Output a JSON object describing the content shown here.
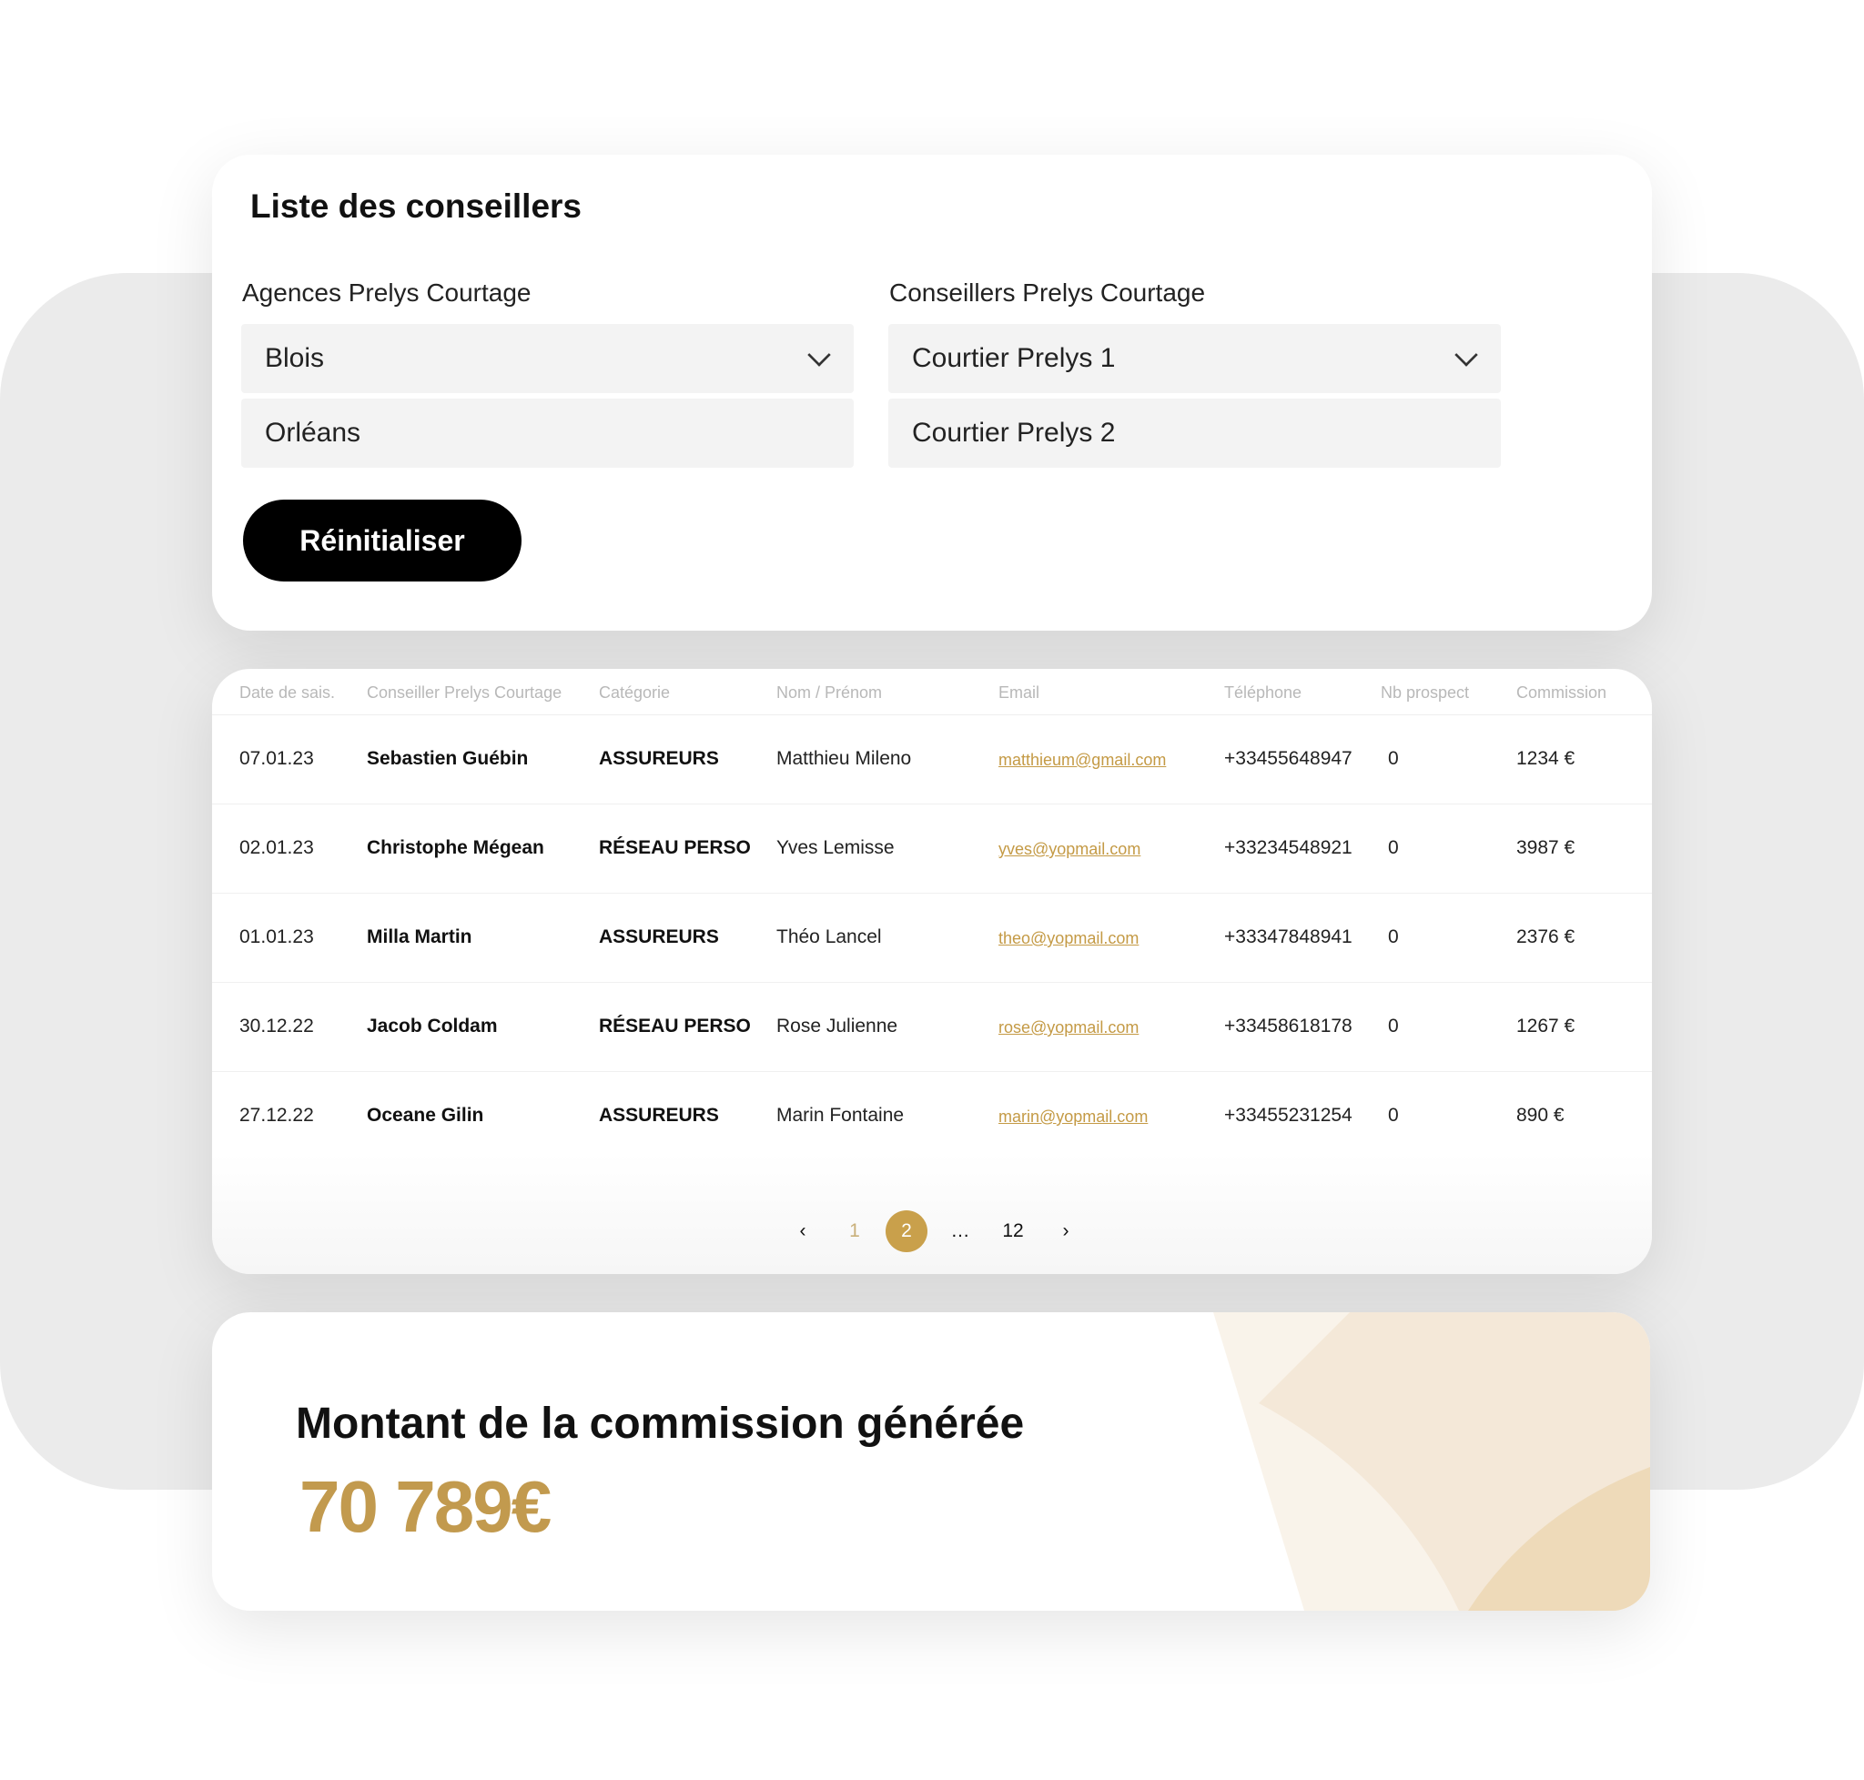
{
  "filters": {
    "title": "Liste des conseillers",
    "agencies_label": "Agences Prelys Courtage",
    "agencies_options": [
      "Blois",
      "Orléans"
    ],
    "advisors_label": "Conseillers Prelys Courtage",
    "advisors_options": [
      "Courtier Prelys 1",
      "Courtier Prelys 2"
    ],
    "reset_label": "Réinitialiser"
  },
  "table": {
    "headers": [
      "Date de sais.",
      "Conseiller Prelys Courtage",
      "Catégorie",
      "Nom / Prénom",
      "Email",
      "Téléphone",
      "Nb prospect",
      "Commission"
    ],
    "rows": [
      [
        "07.01.23",
        "Sebastien Guébin",
        "ASSUREURS",
        "Matthieu Mileno",
        "matthieum@gmail.com",
        "+33455648947",
        "0",
        "1234 €"
      ],
      [
        "02.01.23",
        "Christophe Mégean",
        "RÉSEAU PERSO",
        "Yves Lemisse",
        "yves@yopmail.com",
        "+33234548921",
        "0",
        "3987 €"
      ],
      [
        "01.01.23",
        "Milla Martin",
        "ASSUREURS",
        "Théo Lancel",
        "theo@yopmail.com",
        "+33347848941",
        "0",
        "2376 €"
      ],
      [
        "30.12.22",
        "Jacob Coldam",
        "RÉSEAU PERSO",
        "Rose Julienne",
        "rose@yopmail.com",
        "+33458618178",
        "0",
        "1267 €"
      ],
      [
        "27.12.22",
        "Oceane Gilin",
        "ASSUREURS",
        "Marin Fontaine",
        "marin@yopmail.com",
        "+33455231254",
        "0",
        "890 €"
      ]
    ]
  },
  "pagination": {
    "pages": [
      "1",
      "2",
      "…",
      "12"
    ],
    "current": "2"
  },
  "total": {
    "title": "Montant de la commission générée",
    "amount": "70 789€"
  },
  "colors": {
    "accent": "#c9a04b",
    "button": "#000000"
  }
}
